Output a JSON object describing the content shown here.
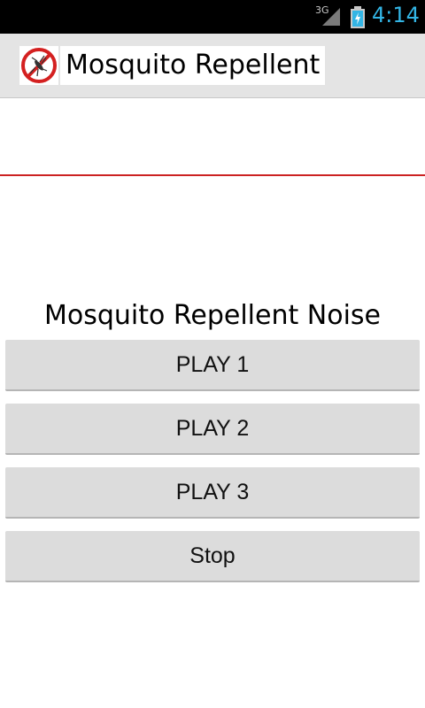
{
  "status_bar": {
    "network": "3G",
    "time": "4:14",
    "clock_color": "#33b5e5",
    "icons": [
      "signal-icon",
      "battery-charging-icon"
    ]
  },
  "action_bar": {
    "app_icon": "no-mosquito-icon",
    "title": "Mosquito Repellent"
  },
  "main": {
    "heading": "Mosquito Repellent Noise",
    "buttons": [
      {
        "label": "PLAY 1"
      },
      {
        "label": "PLAY 2"
      },
      {
        "label": "PLAY 3"
      },
      {
        "label": "Stop"
      }
    ]
  },
  "colors": {
    "divider": "#cc2222",
    "button_bg": "#dcdcdc",
    "action_bar_bg": "#e4e4e4"
  }
}
